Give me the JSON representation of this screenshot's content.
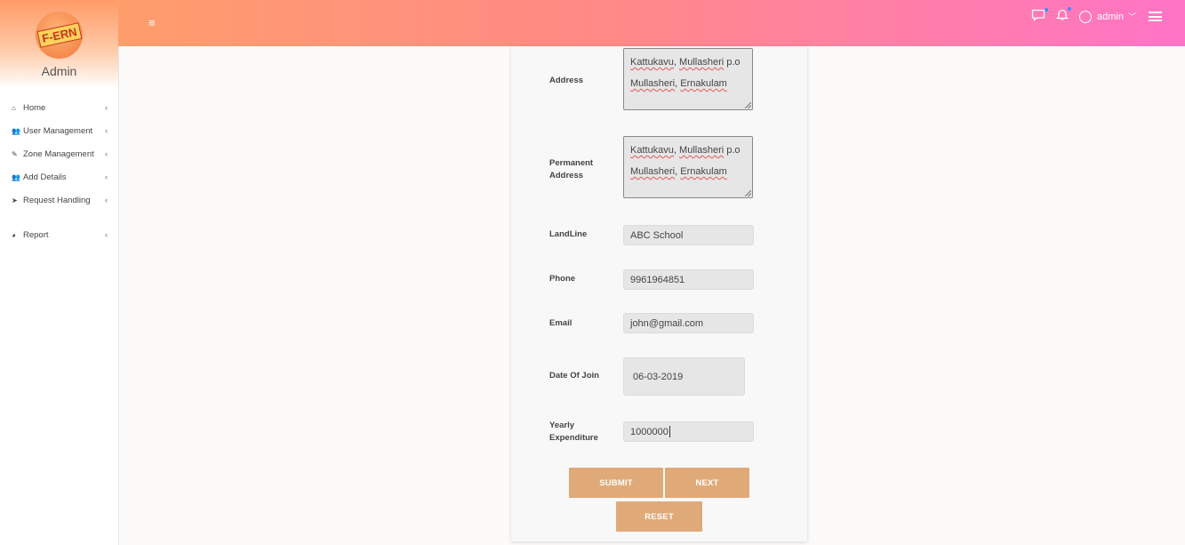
{
  "sidebar": {
    "logo_text": "F-ERN",
    "brand_name": "Admin",
    "items": [
      {
        "icon": "home-icon",
        "glyph": "⌂",
        "label": "Home"
      },
      {
        "icon": "user-add-icon",
        "glyph": "👥",
        "label": "User Management"
      },
      {
        "icon": "edit-icon",
        "glyph": "✎",
        "label": "Zone Management"
      },
      {
        "icon": "user-add-icon",
        "glyph": "👥",
        "label": "Add Details"
      },
      {
        "icon": "send-icon",
        "glyph": "➤",
        "label": "Request Handling"
      },
      {
        "icon": "pie-chart-icon",
        "glyph": "◕",
        "label": "Report"
      }
    ]
  },
  "topbar": {
    "hamburger": "≡",
    "user_name": "admin",
    "accent_gradient": [
      "#ff9d6c",
      "#ff74c6"
    ]
  },
  "form": {
    "address": {
      "label": "Address",
      "line1_a": "Kattukavu",
      "line1_b": ", ",
      "line1_c": "Mullasheri",
      "line1_d": " p.o",
      "line2_a": "Mullasheri",
      "line2_b": ", ",
      "line2_c": "Ernakulam"
    },
    "permanent_address": {
      "label_1": "Permanent",
      "label_2": "Address",
      "line1_a": "Kattukavu",
      "line1_b": ", ",
      "line1_c": "Mullasheri",
      "line1_d": " p.o",
      "line2_a": "Mullasheri",
      "line2_b": ", ",
      "line2_c": "Ernakulam"
    },
    "landline": {
      "label": "LandLine",
      "value": "ABC School"
    },
    "phone": {
      "label": "Phone",
      "value": "9961964851"
    },
    "email": {
      "label": "Email",
      "value": "john@gmail.com"
    },
    "date_of_join": {
      "label": "Date Of Join",
      "value": "06-03-2019"
    },
    "yearly_expenditure": {
      "label_1": "Yearly",
      "label_2": "Expenditure",
      "value": "1000000"
    },
    "buttons": {
      "submit": "SUBMIT",
      "next": "NEXT",
      "reset": "RESET"
    },
    "button_color": "#e0aa78"
  }
}
